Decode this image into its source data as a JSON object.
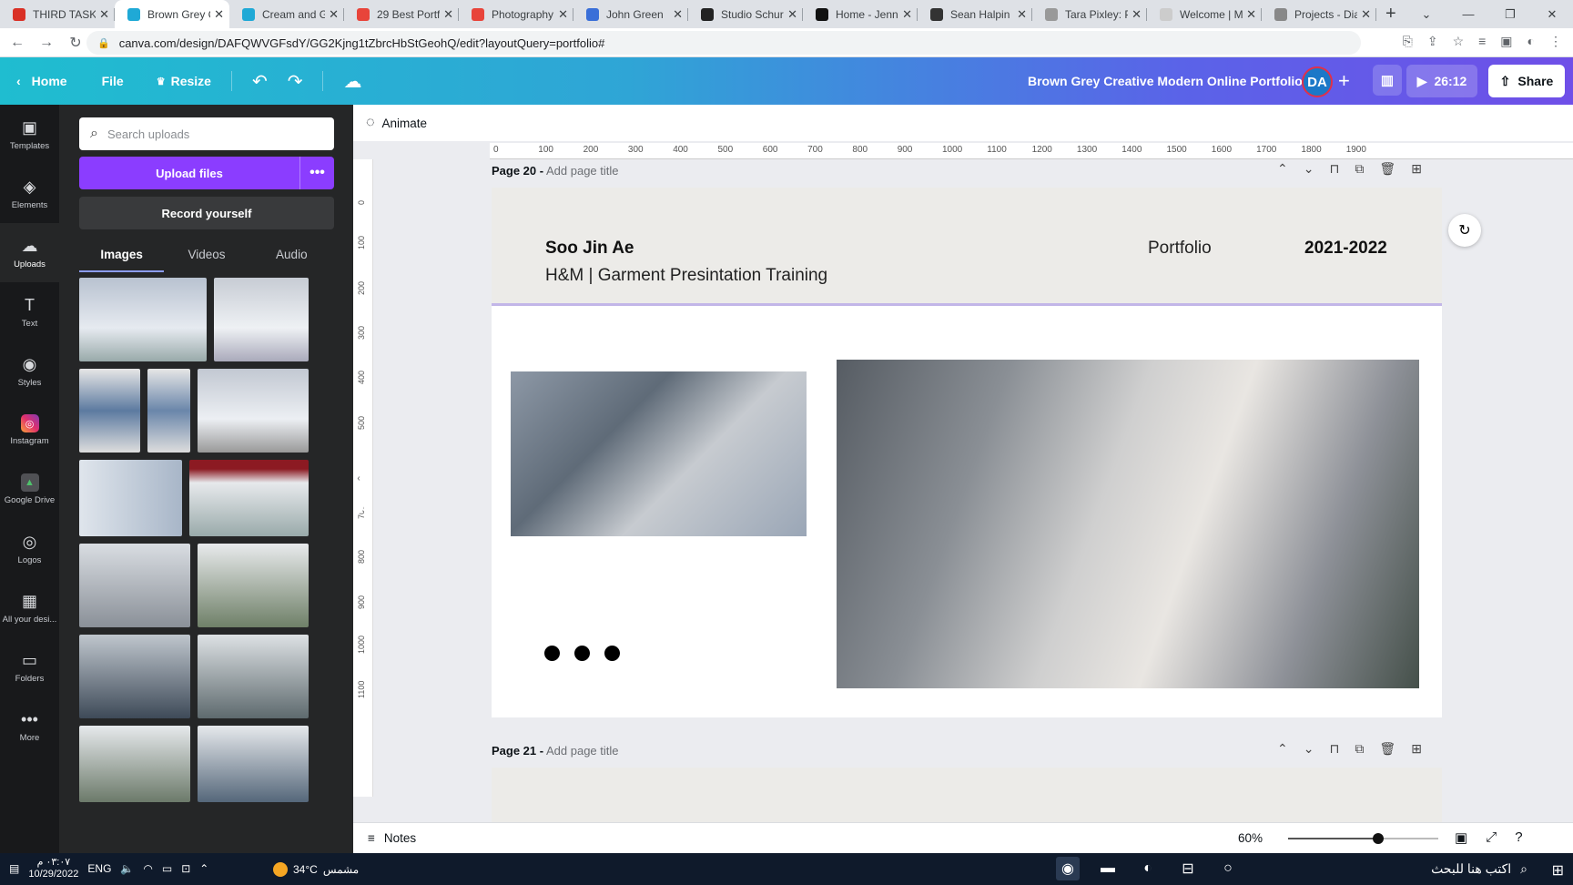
{
  "browser": {
    "tabs": [
      {
        "label": "THIRD TASK",
        "color": "#d93025"
      },
      {
        "label": "Brown Grey C",
        "color": "#1fa9d6",
        "active": true
      },
      {
        "label": "Cream and G",
        "color": "#1fa9d6"
      },
      {
        "label": "29 Best Portf",
        "color": "#e8443a"
      },
      {
        "label": "Photography",
        "color": "#e8443a"
      },
      {
        "label": "John Green",
        "color": "#3a6fd8"
      },
      {
        "label": "Studio Schurk",
        "color": "#222222"
      },
      {
        "label": "Home - Jenn",
        "color": "#111111"
      },
      {
        "label": "Sean Halpin",
        "color": "#333333"
      },
      {
        "label": "Tara Pixley: P",
        "color": "#999999"
      },
      {
        "label": "Welcome | M",
        "color": "#cccccc"
      },
      {
        "label": "Projects - Dia",
        "color": "#888888"
      }
    ],
    "url": "canva.com/design/DAFQWVGFsdY/GG2Kjng1tZbrcHbStGeohQ/edit?layoutQuery=portfolio#"
  },
  "canva_bar": {
    "home": "Home",
    "file": "File",
    "resize": "Resize",
    "title": "Brown Grey Creative Modern Online Portfolio",
    "avatar": "DA",
    "timer": "26:12",
    "share": "Share"
  },
  "rail": [
    {
      "label": "Templates",
      "icon": "templates-icon",
      "glyph": "▣"
    },
    {
      "label": "Elements",
      "icon": "elements-icon",
      "glyph": "◈"
    },
    {
      "label": "Uploads",
      "icon": "uploads-icon",
      "glyph": "☁",
      "active": true
    },
    {
      "label": "Text",
      "icon": "text-icon",
      "glyph": "T"
    },
    {
      "label": "Styles",
      "icon": "styles-icon",
      "glyph": "◉"
    },
    {
      "label": "Instagram",
      "icon": "instagram-icon",
      "glyph": ""
    },
    {
      "label": "Google Drive",
      "icon": "google-drive-icon",
      "glyph": ""
    },
    {
      "label": "Logos",
      "icon": "logos-icon",
      "glyph": "◎"
    },
    {
      "label": "All your desi...",
      "icon": "designs-icon",
      "glyph": "▦"
    },
    {
      "label": "Folders",
      "icon": "folder-icon",
      "glyph": "▭"
    },
    {
      "label": "More",
      "icon": "more-icon",
      "glyph": "•••"
    }
  ],
  "panel": {
    "search_placeholder": "Search uploads",
    "upload_label": "Upload files",
    "record_label": "Record yourself",
    "tabs": [
      "Images",
      "Videos",
      "Audio"
    ]
  },
  "editor": {
    "animate": "Animate",
    "ruler_ticks": [
      "0",
      "100",
      "200",
      "300",
      "400",
      "500",
      "600",
      "700",
      "800",
      "900",
      "1000",
      "1100",
      "1200",
      "1300",
      "1400",
      "1500",
      "1600",
      "1700",
      "1800",
      "1900"
    ],
    "vruler_ticks": [
      "0",
      "100",
      "200",
      "300",
      "400",
      "500",
      "600",
      "700",
      "800",
      "900",
      "1000",
      "1100"
    ],
    "page20_num": "Page 20 -",
    "page20_title": "Add page title",
    "page21_num": "Page 21 -",
    "page21_title": "Add page title",
    "design": {
      "name": "Soo Jin Ae",
      "subtitle": "H&M | Garment Presintation Training",
      "portfolio": "Portfolio",
      "years": "2021-2022"
    },
    "notes": "Notes",
    "zoom": "60%",
    "zoom_level": 0.6
  },
  "taskbar": {
    "time": "٠٣:٠٧ م",
    "date": "10/29/2022",
    "lang": "ENG",
    "temp": "34°C",
    "weather": "مشمس",
    "search": "اكتب هنا للبحث"
  }
}
